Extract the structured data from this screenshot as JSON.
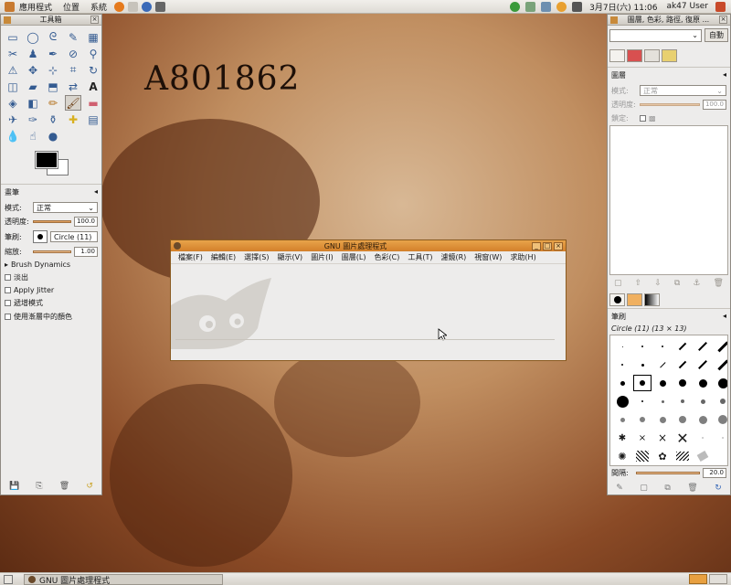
{
  "top_panel": {
    "menus": [
      "應用程式",
      "位置",
      "系統"
    ],
    "clock": "3月7日(六) 11:06",
    "user": "ak47 User"
  },
  "desktop": {
    "watermark": "A801862"
  },
  "toolbox": {
    "title": "工具箱",
    "options_title": "畫筆",
    "mode_label": "模式:",
    "mode_value": "正常",
    "opacity_label": "透明度:",
    "opacity_value": "100.0",
    "brush_label": "筆刷:",
    "brush_value": "Circle (11)",
    "scale_label": "縮放:",
    "scale_value": "1.00",
    "brush_dynamics": "Brush Dynamics",
    "fade_out": "淡出",
    "apply_jitter": "Apply Jitter",
    "incremental": "遞增模式",
    "use_gradient": "使用漸層中的顏色"
  },
  "gimp_window": {
    "title": "GNU 圖片處理程式",
    "menus": [
      "檔案(F)",
      "編輯(E)",
      "選擇(S)",
      "顯示(V)",
      "圖片(I)",
      "圖層(L)",
      "色彩(C)",
      "工具(T)",
      "濾鏡(R)",
      "視窗(W)",
      "求助(H)"
    ]
  },
  "dock": {
    "title": "圖層, 色彩, 路徑, 復原 ...",
    "auto_button": "自動",
    "layers_title": "圖層",
    "mode_label": "模式:",
    "mode_value": "正常",
    "opacity_label": "透明度:",
    "opacity_value": "100.0",
    "lock_label": "鎖定:",
    "brushes_title": "筆刷",
    "brush_info": "Circle (11) (13 × 13)",
    "spacing_label": "間隔:",
    "spacing_value": "20.0"
  },
  "taskbar": {
    "task_label": "GNU 圖片處理程式"
  },
  "colors": {
    "accent": "#d3802a",
    "panel_bg": "#edeceb",
    "fg_color": "#000000",
    "bg_color": "#ffffff"
  }
}
